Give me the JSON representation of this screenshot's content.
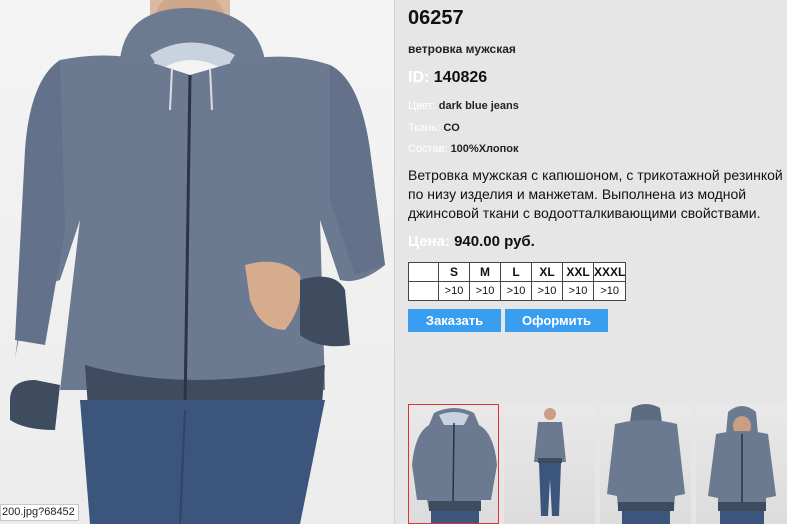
{
  "product": {
    "article": "06257",
    "subtitle": "ветровка мужская",
    "id_label": "ID:",
    "id_value": "140826",
    "color_label": "Цвет:",
    "color_value": "dark blue jeans",
    "fabric_label": "Ткань:",
    "fabric_value": "CO",
    "composition_label": "Состав:",
    "composition_value": "100%Хлопок",
    "description": "Ветровка мужская с капюшоном, с трикотажной резинкой по низу изделия  и манжетам. Выполнена из модной джинсовой ткани с водоотталкивающими свойствами.",
    "price_label": "Цена:",
    "price_value": "940.00 руб."
  },
  "sizes": {
    "headers": [
      "S",
      "M",
      "L",
      "XL",
      "XXL",
      "XXXL"
    ],
    "stock": [
      ">10",
      ">10",
      ">10",
      ">10",
      ">10",
      ">10"
    ]
  },
  "buttons": {
    "order": "Заказать",
    "checkout": "Оформить"
  },
  "status_url": "200.jpg?68452",
  "colors": {
    "accent_button": "#3a9ef0",
    "jacket": "#6b7a90",
    "selected_thumb_border": "#dd3333",
    "panel_bg": "#e6e6e6"
  }
}
